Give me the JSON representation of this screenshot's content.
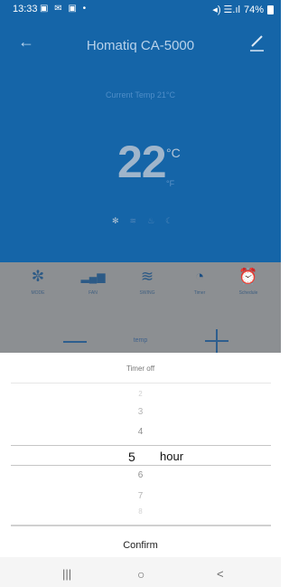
{
  "status_bar": {
    "time": "13:33",
    "notifications": "▣ ✉ ▣ •",
    "signal": "◂) ☰.ıl",
    "battery": "74%"
  },
  "header": {
    "title": "Homatiq CA-5000"
  },
  "temperature": {
    "current_label": "Current Temp 21°C",
    "set_value": "22",
    "unit_c": "°C",
    "unit_f": "°F"
  },
  "status_icons": [
    "✻",
    "≋",
    "♨",
    "☾"
  ],
  "modes": [
    {
      "label": "MODE",
      "icon": "✼"
    },
    {
      "label": "FAN",
      "icon": "▂▄▆"
    },
    {
      "label": "SWING",
      "icon": "≋"
    },
    {
      "label": "Timer",
      "icon": "◔"
    },
    {
      "label": "Schedule",
      "icon": "⏰"
    }
  ],
  "temp_control": {
    "label": "temp"
  },
  "timer_sheet": {
    "title": "Timer off",
    "options_above": [
      "2",
      "3",
      "4"
    ],
    "selected": {
      "value": "5",
      "unit": "hour"
    },
    "options_below": [
      "6",
      "7",
      "8"
    ],
    "confirm": "Confirm"
  },
  "nav_bar": {
    "recents": "|||",
    "home": "○",
    "back": "<"
  },
  "colors": {
    "primary_blue": "#1565a8",
    "dim_overlay": "#8c8f92",
    "sheet_bg": "#ffffff"
  }
}
